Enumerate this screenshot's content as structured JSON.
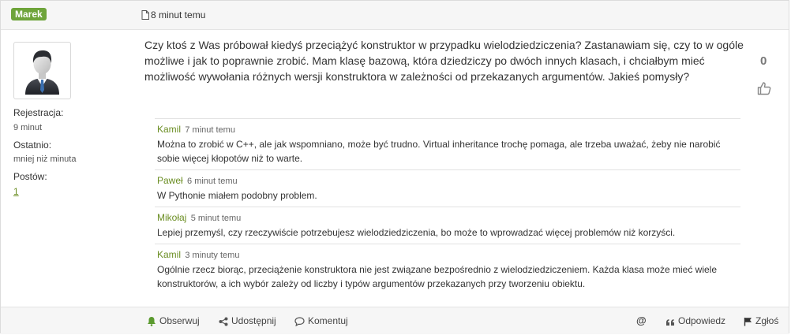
{
  "post": {
    "author": "Marek",
    "time": "8 minut temu",
    "body": "Czy ktoś z Was próbował kiedyś przeciążyć konstruktor w przypadku wielodziedziczenia? Zastanawiam się, czy to w ogóle możliwe i jak to poprawnie zrobić. Mam klasę bazową, która dziedziczy po dwóch innych klasach, i chciałbym mieć możliwość wywołania różnych wersji konstruktora w zależności od przekazanych argumentów. Jakieś pomysły?",
    "votes": "0"
  },
  "user": {
    "registration_label": "Rejestracja:",
    "registration_value": "9 minut",
    "last_label": "Ostatnio:",
    "last_value": "mniej niż minuta",
    "posts_label": "Postów:",
    "posts_value": "1"
  },
  "comments": [
    {
      "author": "Kamil",
      "time": "7 minut temu",
      "text": "Można to zrobić w C++, ale jak wspomniano, może być trudno. Virtual inheritance trochę pomaga, ale trzeba uważać, żeby nie narobić sobie więcej kłopotów niż to warte."
    },
    {
      "author": "Paweł",
      "time": "6 minut temu",
      "text": "W Pythonie miałem podobny problem."
    },
    {
      "author": "Mikołaj",
      "time": "5 minut temu",
      "text": "Lepiej przemyśl, czy rzeczywiście potrzebujesz wielodziedziczenia, bo może to wprowadzać więcej problemów niż korzyści."
    },
    {
      "author": "Kamil",
      "time": "3 minuty temu",
      "text": "Ogólnie rzecz biorąc, przeciążenie konstruktora nie jest związane bezpośrednio z wielodziedziczeniem. Każda klasa może mieć wiele konstruktorów, a ich wybór zależy od liczby i typów argumentów przekazanych przy tworzeniu obiektu."
    }
  ],
  "footer": {
    "observe": "Obserwuj",
    "share": "Udostępnij",
    "comment": "Komentuj",
    "mention": "@",
    "reply": "Odpowiedz",
    "report": "Zgłoś"
  },
  "icons": [
    "document-icon",
    "like-icon",
    "bell-icon",
    "share-icon",
    "comment-icon",
    "quote-icon",
    "flag-icon"
  ],
  "colors": {
    "accent": "#6ea43a",
    "link": "#6b8e23"
  }
}
